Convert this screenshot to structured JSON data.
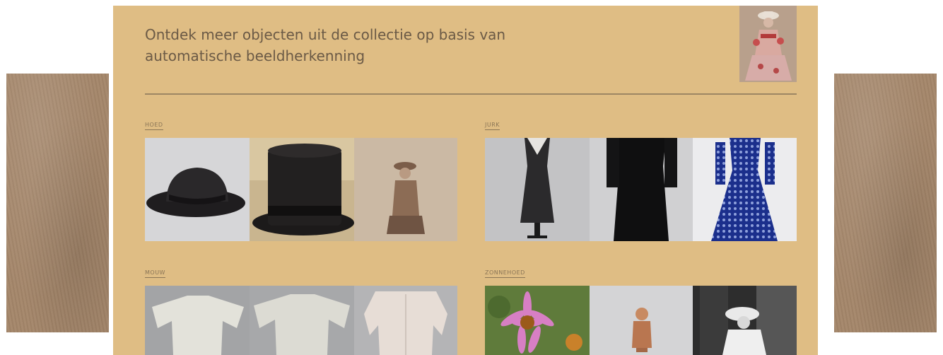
{
  "intro": {
    "text": "Ontdek meer objecten uit de collectie op basis van\nautomatische beeldherkenning"
  },
  "categories": [
    {
      "label": "HOED"
    },
    {
      "label": "JURK"
    },
    {
      "label": "MOUW"
    },
    {
      "label": "ZONNEHOED"
    }
  ],
  "colors": {
    "card_background": "#dfbd84",
    "intro_text": "#6b5a46",
    "divider": "#9d8664",
    "side_texture": "#a4866a"
  }
}
